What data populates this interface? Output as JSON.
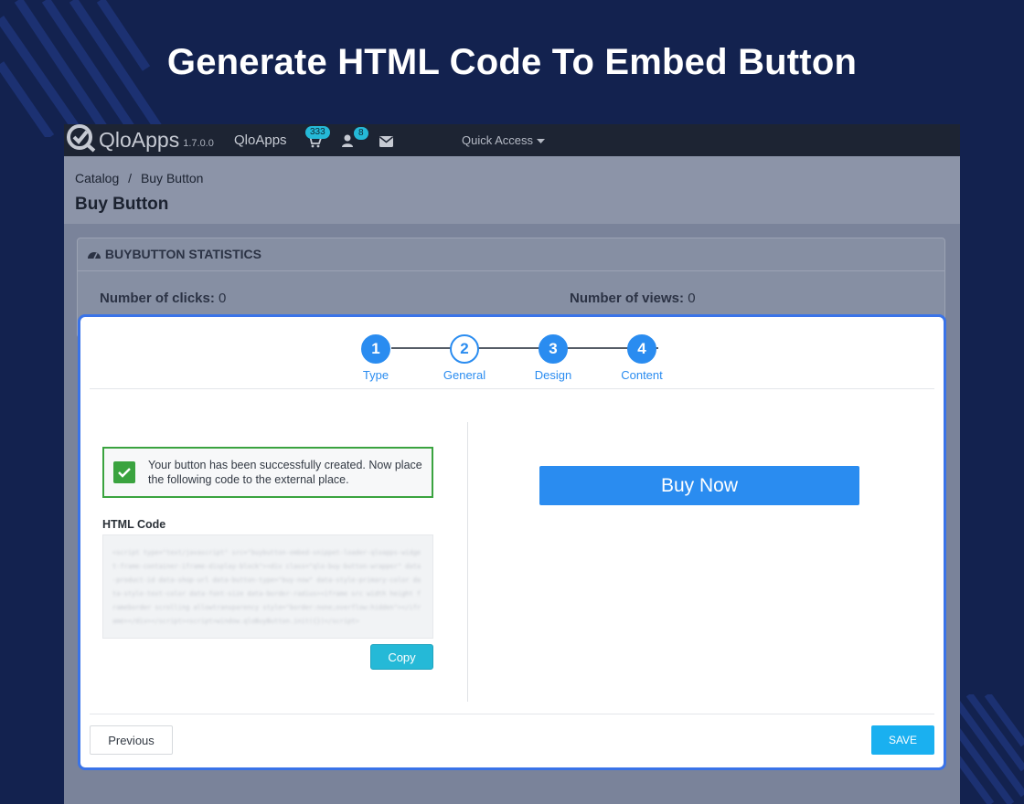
{
  "promo": {
    "title": "Generate HTML Code To Embed Button"
  },
  "topbar": {
    "logo_text": "QloApps",
    "version": "1.7.0.0",
    "shop_name": "QloApps",
    "orders_badge": "333",
    "customers_badge": "8",
    "quick_access": "Quick Access",
    "icons": [
      "qloapps-logo-icon",
      "cart-icon",
      "user-icon",
      "envelope-icon",
      "caret-down-icon"
    ]
  },
  "header": {
    "breadcrumb": [
      "Catalog",
      "/",
      "Buy Button"
    ],
    "page_title": "Buy Button"
  },
  "statistics": {
    "title": "BUYBUTTON STATISTICS",
    "icon": "dashboard-icon",
    "clicks_label": "Number of clicks:",
    "clicks_value": "0",
    "views_label": "Number of views:",
    "views_value": "0"
  },
  "wizard": {
    "steps": [
      {
        "number": "1",
        "label": "Type",
        "state": "done"
      },
      {
        "number": "2",
        "label": "General",
        "state": "outline"
      },
      {
        "number": "3",
        "label": "Design",
        "state": "done"
      },
      {
        "number": "4",
        "label": "Content",
        "state": "done"
      }
    ]
  },
  "result": {
    "success_message": "Your button has been successfully created. Now place the following code to the external place.",
    "html_code_label": "HTML Code",
    "copy_label": "Copy",
    "preview_button_label": "Buy Now"
  },
  "footer": {
    "previous_label": "Previous",
    "save_label": "SAVE"
  },
  "colors": {
    "background": "#13224f",
    "accent": "#2a8cf0",
    "modal_border": "#3a73e8",
    "success": "#3aa33f",
    "copy_button": "#25b9d7",
    "save_button": "#1ab0f0"
  }
}
